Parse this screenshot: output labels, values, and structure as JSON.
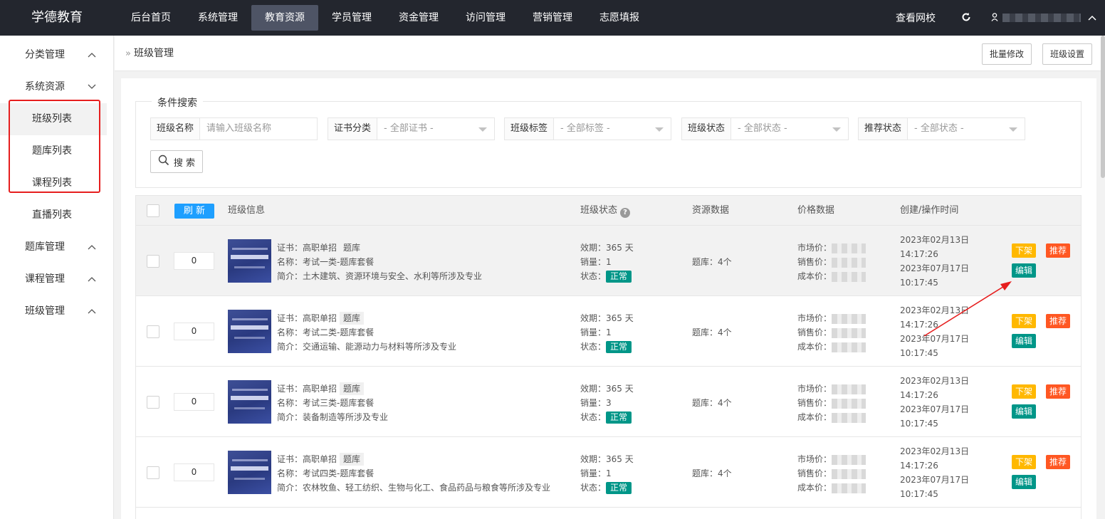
{
  "topbar": {
    "logo": "学德教育",
    "nav": [
      "后台首页",
      "系统管理",
      "教育资源",
      "学员管理",
      "资金管理",
      "访问管理",
      "营销管理",
      "志愿填报"
    ],
    "view_site": "查看网校",
    "refresh_icon": "refresh-icon",
    "user_icon": "user-icon"
  },
  "sidebar": {
    "groups": [
      {
        "label": "分类管理",
        "chevron": "up"
      },
      {
        "label": "系统资源",
        "chevron": "down"
      },
      {
        "label": "题库管理",
        "chevron": "up"
      },
      {
        "label": "课程管理",
        "chevron": "up"
      },
      {
        "label": "班级管理",
        "chevron": "up"
      }
    ],
    "sub_items": [
      "班级列表",
      "题库列表",
      "课程列表",
      "直播列表"
    ],
    "selected": "班级列表"
  },
  "header": {
    "breadcrumb": "班级管理",
    "batch_edit": "批量修改",
    "class_settings": "班级设置"
  },
  "filters": {
    "legend": "条件搜索",
    "class_name": {
      "label": "班级名称",
      "placeholder": "请输入班级名称"
    },
    "cert": {
      "label": "证书分类",
      "value": "- 全部证书 -"
    },
    "tag": {
      "label": "班级标签",
      "value": "- 全部标签 -"
    },
    "status": {
      "label": "班级状态",
      "value": "- 全部状态 -"
    },
    "recommend": {
      "label": "推荐状态",
      "value": "- 全部状态 -"
    },
    "search_button": "搜 索"
  },
  "table": {
    "refresh": "刷 新",
    "headers": {
      "info": "班级信息",
      "status": "班级状态",
      "resource": "资源数据",
      "price": "价格数据",
      "time": "创建/操作时间"
    },
    "rows": [
      {
        "sort": "0",
        "cert": "证书：高职单招",
        "cert_tag": "题库",
        "name": "名称：考试一类-题库套餐",
        "intro": "简介：土木建筑、资源环境与安全、水利等所涉及专业",
        "validity": "效期：365 天",
        "sales": "销量：1",
        "status_label": "状态：",
        "status": "正常",
        "resource": "题库：4个",
        "market_label": "市场价：",
        "sale_label": "销售价：",
        "cost_label": "成本价：",
        "created_date": "2023年02月13日",
        "created_time": "14:17:26",
        "updated_date": "2023年07月17日",
        "updated_time": "10:17:45",
        "btn_off": "下架",
        "btn_recommend": "推荐",
        "btn_edit": "编辑"
      },
      {
        "sort": "0",
        "cert": "证书：高职单招",
        "cert_tag": "题库",
        "name": "名称：考试二类-题库套餐",
        "intro": "简介：交通运输、能源动力与材料等所涉及专业",
        "validity": "效期：365 天",
        "sales": "销量：1",
        "status_label": "状态：",
        "status": "正常",
        "resource": "题库：4个",
        "market_label": "市场价：",
        "sale_label": "销售价：",
        "cost_label": "成本价：",
        "created_date": "2023年02月13日",
        "created_time": "14:17:26",
        "updated_date": "2023年07月17日",
        "updated_time": "10:17:45",
        "btn_off": "下架",
        "btn_recommend": "推荐",
        "btn_edit": "编辑"
      },
      {
        "sort": "0",
        "cert": "证书：高职单招",
        "cert_tag": "题库",
        "name": "名称：考试三类-题库套餐",
        "intro": "简介：装备制造等所涉及专业",
        "validity": "效期：365 天",
        "sales": "销量：3",
        "status_label": "状态：",
        "status": "正常",
        "resource": "题库：4个",
        "market_label": "市场价：",
        "sale_label": "销售价：",
        "cost_label": "成本价：",
        "created_date": "2023年02月13日",
        "created_time": "14:17:26",
        "updated_date": "2023年07月17日",
        "updated_time": "10:17:45",
        "btn_off": "下架",
        "btn_recommend": "推荐",
        "btn_edit": "编辑"
      },
      {
        "sort": "0",
        "cert": "证书：高职单招",
        "cert_tag": "题库",
        "name": "名称：考试四类-题库套餐",
        "intro": "简介：农林牧鱼、轻工纺织、生物与化工、食品药品与粮食等所涉及专业",
        "validity": "效期：365 天",
        "sales": "销量：1",
        "status_label": "状态：",
        "status": "正常",
        "resource": "题库：4个",
        "market_label": "市场价：",
        "sale_label": "销售价：",
        "cost_label": "成本价：",
        "created_date": "2023年02月13日",
        "created_time": "14:17:26",
        "updated_date": "2023年07月17日",
        "updated_time": "10:17:45",
        "btn_off": "下架",
        "btn_recommend": "推荐",
        "btn_edit": "编辑"
      }
    ]
  },
  "colors": {
    "topbar": "#23262e",
    "accent_blue": "#1e9fff",
    "status_green": "#009688",
    "btn_yellow": "#ffb800",
    "btn_orange": "#ff5722",
    "annotation_red": "#e61e1e"
  }
}
